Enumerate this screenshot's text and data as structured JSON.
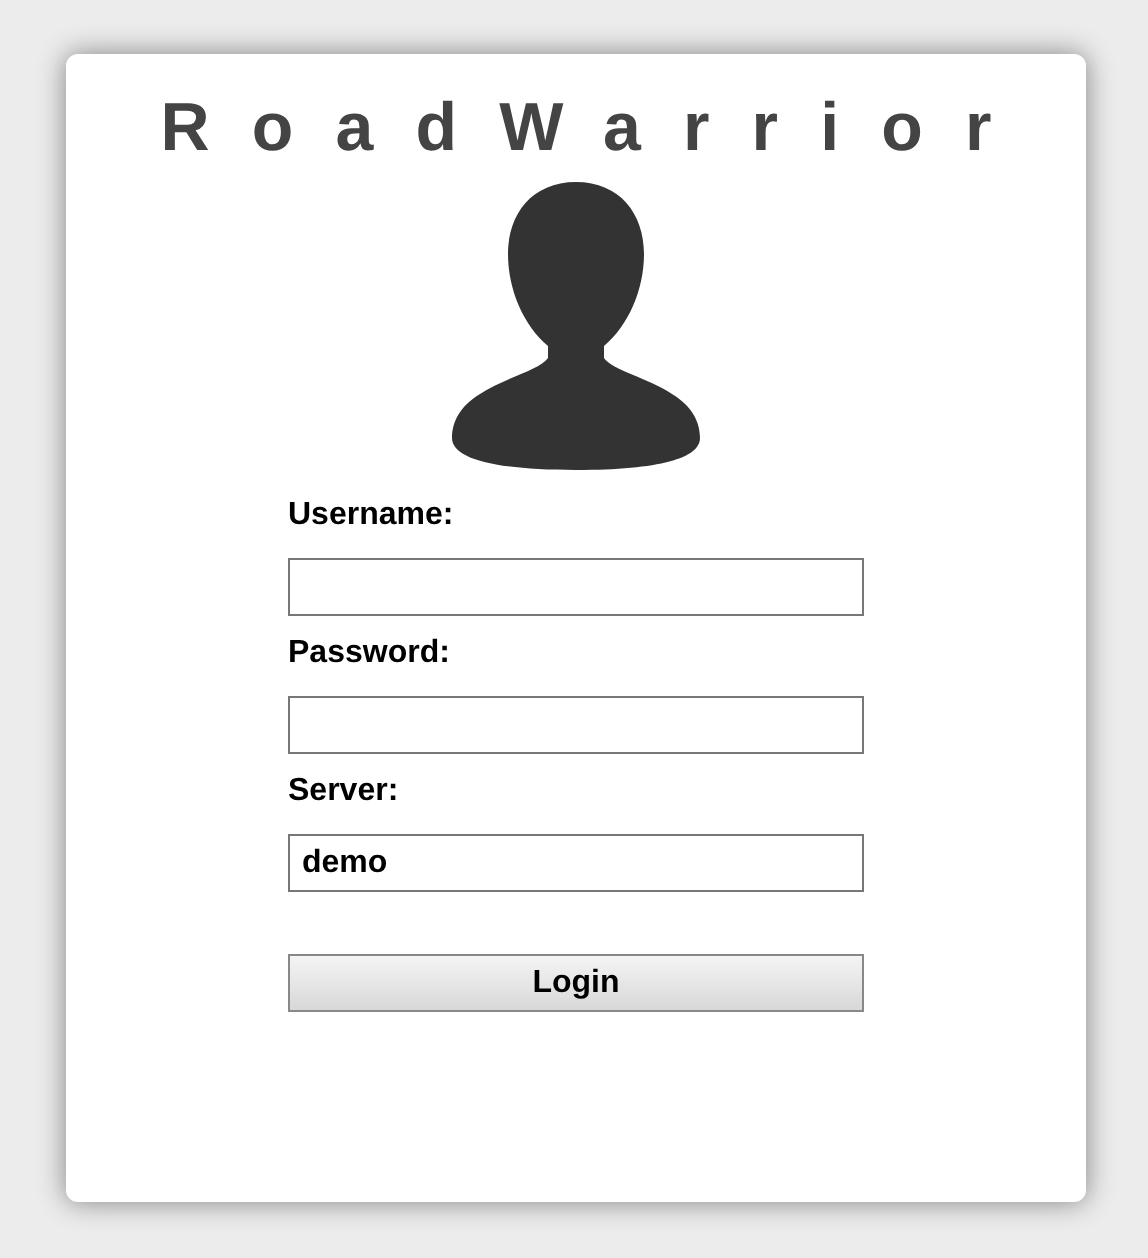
{
  "title": "RoadWarrior",
  "fields": [
    {
      "label": "Username:"
    },
    {
      "label": "Password:"
    },
    {
      "label": "Server:",
      "value": "demo"
    }
  ],
  "button": "Login"
}
